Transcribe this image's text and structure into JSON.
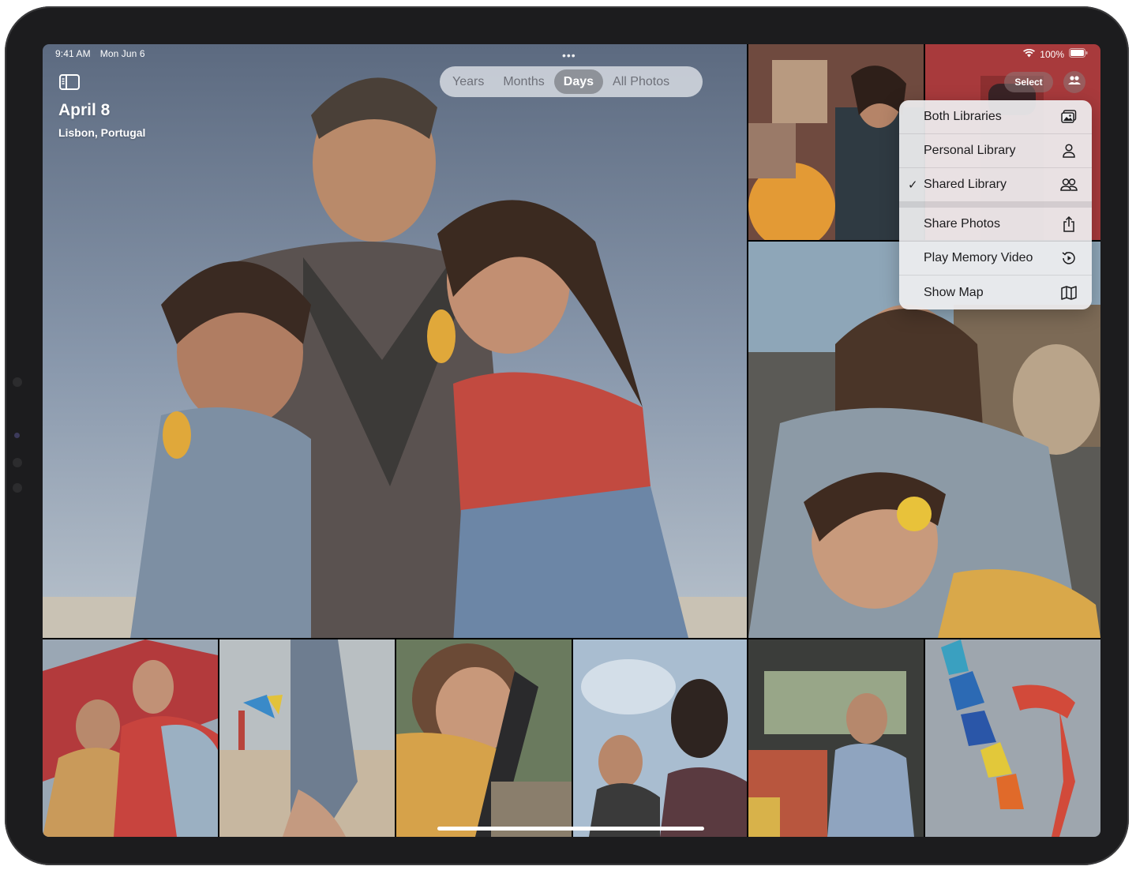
{
  "status_bar": {
    "time": "9:41 AM",
    "date": "Mon Jun 6",
    "battery": "100%"
  },
  "header": {
    "title": "April 8",
    "subtitle": "Lisbon, Portugal",
    "select_label": "Select"
  },
  "view_tabs": [
    {
      "label": "Years",
      "active": false
    },
    {
      "label": "Months",
      "active": false
    },
    {
      "label": "Days",
      "active": true
    },
    {
      "label": "All Photos",
      "active": false
    }
  ],
  "library_menu": {
    "items": [
      {
        "label": "Both Libraries",
        "icon": "photo-stack-icon",
        "checked": false
      },
      {
        "label": "Personal Library",
        "icon": "person-icon",
        "checked": false
      },
      {
        "label": "Shared Library",
        "icon": "people-icon",
        "checked": true
      },
      {
        "label": "Share Photos",
        "icon": "share-icon",
        "checked": false
      },
      {
        "label": "Play Memory Video",
        "icon": "memory-play-icon",
        "checked": false
      },
      {
        "label": "Show Map",
        "icon": "map-icon",
        "checked": false
      }
    ],
    "check_glyph": "✓"
  },
  "colors": {
    "accent_active_tab": "#8e9299",
    "menu_background": "#eeeef0",
    "device_frame": "#1c1c1e"
  }
}
